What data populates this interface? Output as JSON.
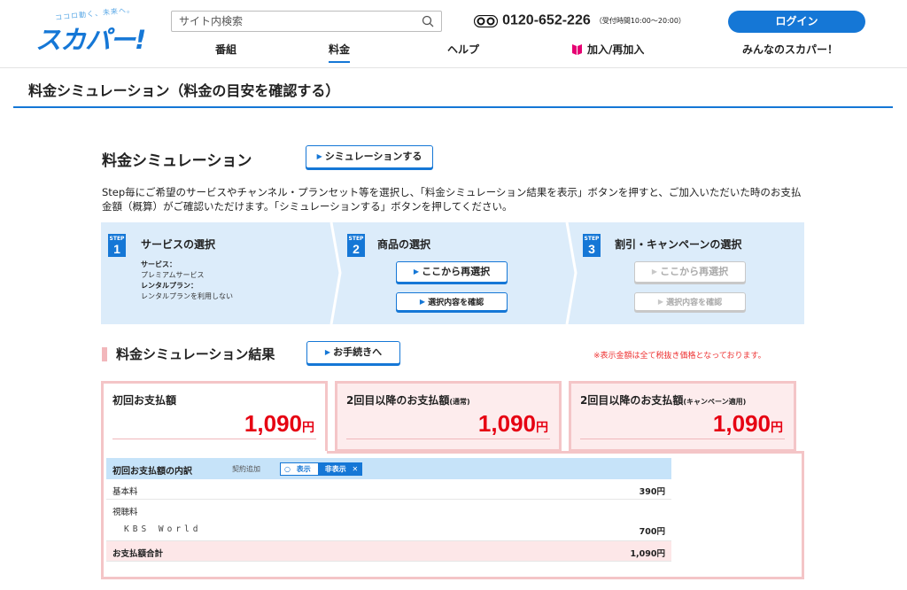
{
  "header": {
    "logo_tagline": "ココロ動く、未来へ。",
    "logo_text": "スカパー!",
    "search_placeholder": "サイト内検索",
    "phone_number": "0120-652-226",
    "phone_hours": "（受付時間10:00～20:00）",
    "login_label": "ログイン",
    "nav": [
      {
        "label": "番組"
      },
      {
        "label": "料金",
        "active": true
      },
      {
        "label": "ヘルプ"
      },
      {
        "label": "加入/再加入"
      },
      {
        "label": "みんなのスカパー！"
      }
    ]
  },
  "page_title": "料金シミュレーション（料金の目安を確認する）",
  "simulation": {
    "title": "料金シミュレーション",
    "simulate_button": "シミュレーションする",
    "description": "Step毎にご希望のサービスやチャンネル・プランセット等を選択し、「料金シミュレーション結果を表示」ボタンを押すと、ご加入いただいた時のお支払金額（概算）がご確認いただけます。「シミュレーションする」ボタンを押してください。"
  },
  "steps": [
    {
      "badge_label": "STEP",
      "number": "1",
      "title": "サービスの選択",
      "service_label": "サービス：",
      "service_value": "プレミアムサービス",
      "rental_label": "レンタルプラン：",
      "rental_value": "レンタルプランを利用しない"
    },
    {
      "badge_label": "STEP",
      "number": "2",
      "title": "商品の選択",
      "reselect_button": "ここから再選択",
      "confirm_button": "選択内容を確認"
    },
    {
      "badge_label": "STEP",
      "number": "3",
      "title": "割引・キャンペーンの選択",
      "reselect_button": "ここから再選択",
      "confirm_button": "選択内容を確認"
    }
  ],
  "results": {
    "title": "料金シミュレーション結果",
    "procedure_button": "お手続きへ",
    "note": "※表示金額は全て税抜き価格となっております。",
    "payments": [
      {
        "label": "初回お支払額",
        "label_small": "",
        "amount": "1,090",
        "unit": "円"
      },
      {
        "label": "2回目以降のお支払額",
        "label_small": "(通常)",
        "amount": "1,090",
        "unit": "円"
      },
      {
        "label": "2回目以降のお支払額",
        "label_small": "(キャンペーン適用)",
        "amount": "1,090",
        "unit": "円"
      }
    ],
    "breakdown": {
      "title": "初回お支払額の内訳",
      "contract_add": "契約追加",
      "toggle_show": "表示",
      "toggle_hide": "非表示",
      "rows": [
        {
          "label": "基本料",
          "value": "390円"
        },
        {
          "label": "視聴料",
          "value": ""
        },
        {
          "label": "KBS World",
          "value": "700円"
        },
        {
          "label": "お支払額合計",
          "value": "1,090円"
        }
      ]
    }
  },
  "colors": {
    "brand_blue": "#1577d6",
    "step_bg": "#dcecfa",
    "price_red": "#e60012",
    "pink_border": "#f4c5c7"
  }
}
